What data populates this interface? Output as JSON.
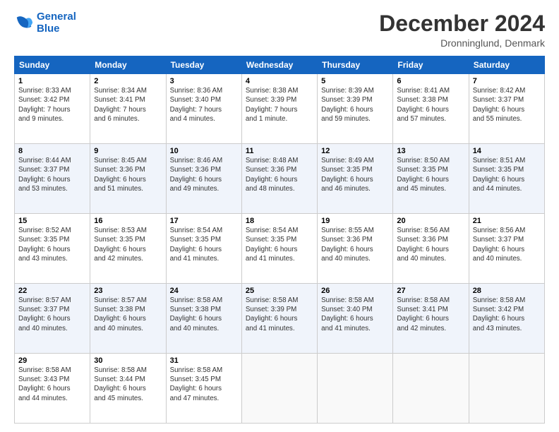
{
  "header": {
    "logo_line1": "General",
    "logo_line2": "Blue",
    "month_title": "December 2024",
    "location": "Dronninglund, Denmark"
  },
  "days_of_week": [
    "Sunday",
    "Monday",
    "Tuesday",
    "Wednesday",
    "Thursday",
    "Friday",
    "Saturday"
  ],
  "weeks": [
    [
      {
        "day": "1",
        "info": "Sunrise: 8:33 AM\nSunset: 3:42 PM\nDaylight: 7 hours\nand 9 minutes."
      },
      {
        "day": "2",
        "info": "Sunrise: 8:34 AM\nSunset: 3:41 PM\nDaylight: 7 hours\nand 6 minutes."
      },
      {
        "day": "3",
        "info": "Sunrise: 8:36 AM\nSunset: 3:40 PM\nDaylight: 7 hours\nand 4 minutes."
      },
      {
        "day": "4",
        "info": "Sunrise: 8:38 AM\nSunset: 3:39 PM\nDaylight: 7 hours\nand 1 minute."
      },
      {
        "day": "5",
        "info": "Sunrise: 8:39 AM\nSunset: 3:39 PM\nDaylight: 6 hours\nand 59 minutes."
      },
      {
        "day": "6",
        "info": "Sunrise: 8:41 AM\nSunset: 3:38 PM\nDaylight: 6 hours\nand 57 minutes."
      },
      {
        "day": "7",
        "info": "Sunrise: 8:42 AM\nSunset: 3:37 PM\nDaylight: 6 hours\nand 55 minutes."
      }
    ],
    [
      {
        "day": "8",
        "info": "Sunrise: 8:44 AM\nSunset: 3:37 PM\nDaylight: 6 hours\nand 53 minutes."
      },
      {
        "day": "9",
        "info": "Sunrise: 8:45 AM\nSunset: 3:36 PM\nDaylight: 6 hours\nand 51 minutes."
      },
      {
        "day": "10",
        "info": "Sunrise: 8:46 AM\nSunset: 3:36 PM\nDaylight: 6 hours\nand 49 minutes."
      },
      {
        "day": "11",
        "info": "Sunrise: 8:48 AM\nSunset: 3:36 PM\nDaylight: 6 hours\nand 48 minutes."
      },
      {
        "day": "12",
        "info": "Sunrise: 8:49 AM\nSunset: 3:35 PM\nDaylight: 6 hours\nand 46 minutes."
      },
      {
        "day": "13",
        "info": "Sunrise: 8:50 AM\nSunset: 3:35 PM\nDaylight: 6 hours\nand 45 minutes."
      },
      {
        "day": "14",
        "info": "Sunrise: 8:51 AM\nSunset: 3:35 PM\nDaylight: 6 hours\nand 44 minutes."
      }
    ],
    [
      {
        "day": "15",
        "info": "Sunrise: 8:52 AM\nSunset: 3:35 PM\nDaylight: 6 hours\nand 43 minutes."
      },
      {
        "day": "16",
        "info": "Sunrise: 8:53 AM\nSunset: 3:35 PM\nDaylight: 6 hours\nand 42 minutes."
      },
      {
        "day": "17",
        "info": "Sunrise: 8:54 AM\nSunset: 3:35 PM\nDaylight: 6 hours\nand 41 minutes."
      },
      {
        "day": "18",
        "info": "Sunrise: 8:54 AM\nSunset: 3:35 PM\nDaylight: 6 hours\nand 41 minutes."
      },
      {
        "day": "19",
        "info": "Sunrise: 8:55 AM\nSunset: 3:36 PM\nDaylight: 6 hours\nand 40 minutes."
      },
      {
        "day": "20",
        "info": "Sunrise: 8:56 AM\nSunset: 3:36 PM\nDaylight: 6 hours\nand 40 minutes."
      },
      {
        "day": "21",
        "info": "Sunrise: 8:56 AM\nSunset: 3:37 PM\nDaylight: 6 hours\nand 40 minutes."
      }
    ],
    [
      {
        "day": "22",
        "info": "Sunrise: 8:57 AM\nSunset: 3:37 PM\nDaylight: 6 hours\nand 40 minutes."
      },
      {
        "day": "23",
        "info": "Sunrise: 8:57 AM\nSunset: 3:38 PM\nDaylight: 6 hours\nand 40 minutes."
      },
      {
        "day": "24",
        "info": "Sunrise: 8:58 AM\nSunset: 3:38 PM\nDaylight: 6 hours\nand 40 minutes."
      },
      {
        "day": "25",
        "info": "Sunrise: 8:58 AM\nSunset: 3:39 PM\nDaylight: 6 hours\nand 41 minutes."
      },
      {
        "day": "26",
        "info": "Sunrise: 8:58 AM\nSunset: 3:40 PM\nDaylight: 6 hours\nand 41 minutes."
      },
      {
        "day": "27",
        "info": "Sunrise: 8:58 AM\nSunset: 3:41 PM\nDaylight: 6 hours\nand 42 minutes."
      },
      {
        "day": "28",
        "info": "Sunrise: 8:58 AM\nSunset: 3:42 PM\nDaylight: 6 hours\nand 43 minutes."
      }
    ],
    [
      {
        "day": "29",
        "info": "Sunrise: 8:58 AM\nSunset: 3:43 PM\nDaylight: 6 hours\nand 44 minutes."
      },
      {
        "day": "30",
        "info": "Sunrise: 8:58 AM\nSunset: 3:44 PM\nDaylight: 6 hours\nand 45 minutes."
      },
      {
        "day": "31",
        "info": "Sunrise: 8:58 AM\nSunset: 3:45 PM\nDaylight: 6 hours\nand 47 minutes."
      },
      {
        "day": "",
        "info": ""
      },
      {
        "day": "",
        "info": ""
      },
      {
        "day": "",
        "info": ""
      },
      {
        "day": "",
        "info": ""
      }
    ]
  ]
}
